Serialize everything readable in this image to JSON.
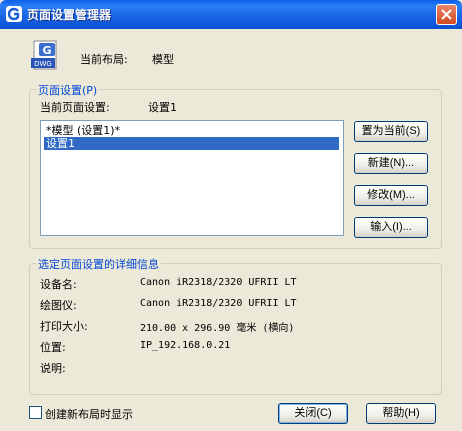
{
  "window": {
    "title": "页面设置管理器"
  },
  "current_layout": {
    "label": "当前布局:",
    "value": "模型"
  },
  "page_setups_group": {
    "title": "页面设置(P)",
    "current_label": "当前页面设置:",
    "current_value": "设置1",
    "items": [
      "*模型 (设置1)*",
      "设置1"
    ],
    "selected_index": 1
  },
  "buttons": {
    "set_current": "置为当前(S)",
    "new": "新建(N)...",
    "modify": "修改(M)...",
    "import": "输入(I)...",
    "close": "关闭(C)",
    "help": "帮助(H)"
  },
  "details_group": {
    "title": "选定页面设置的详细信息",
    "rows": [
      {
        "label": "设备名:",
        "value": "Canon iR2318/2320 UFRII LT"
      },
      {
        "label": "绘图仪:",
        "value": "Canon iR2318/2320 UFRII LT"
      },
      {
        "label": "打印大小:",
        "value": "210.00 x 296.90 毫米 (横向)"
      },
      {
        "label": "位置:",
        "value": "IP_192.168.0.21"
      },
      {
        "label": "说明:",
        "value": ""
      }
    ]
  },
  "show_on_new_layout": {
    "label": "创建新布局时显示",
    "checked": false
  },
  "icons": {
    "app": "app-logo-icon",
    "dwg": "DWG"
  },
  "colors": {
    "titlebar": "#0a5fe8",
    "selection": "#316ac5",
    "group_title": "#0046d5"
  }
}
